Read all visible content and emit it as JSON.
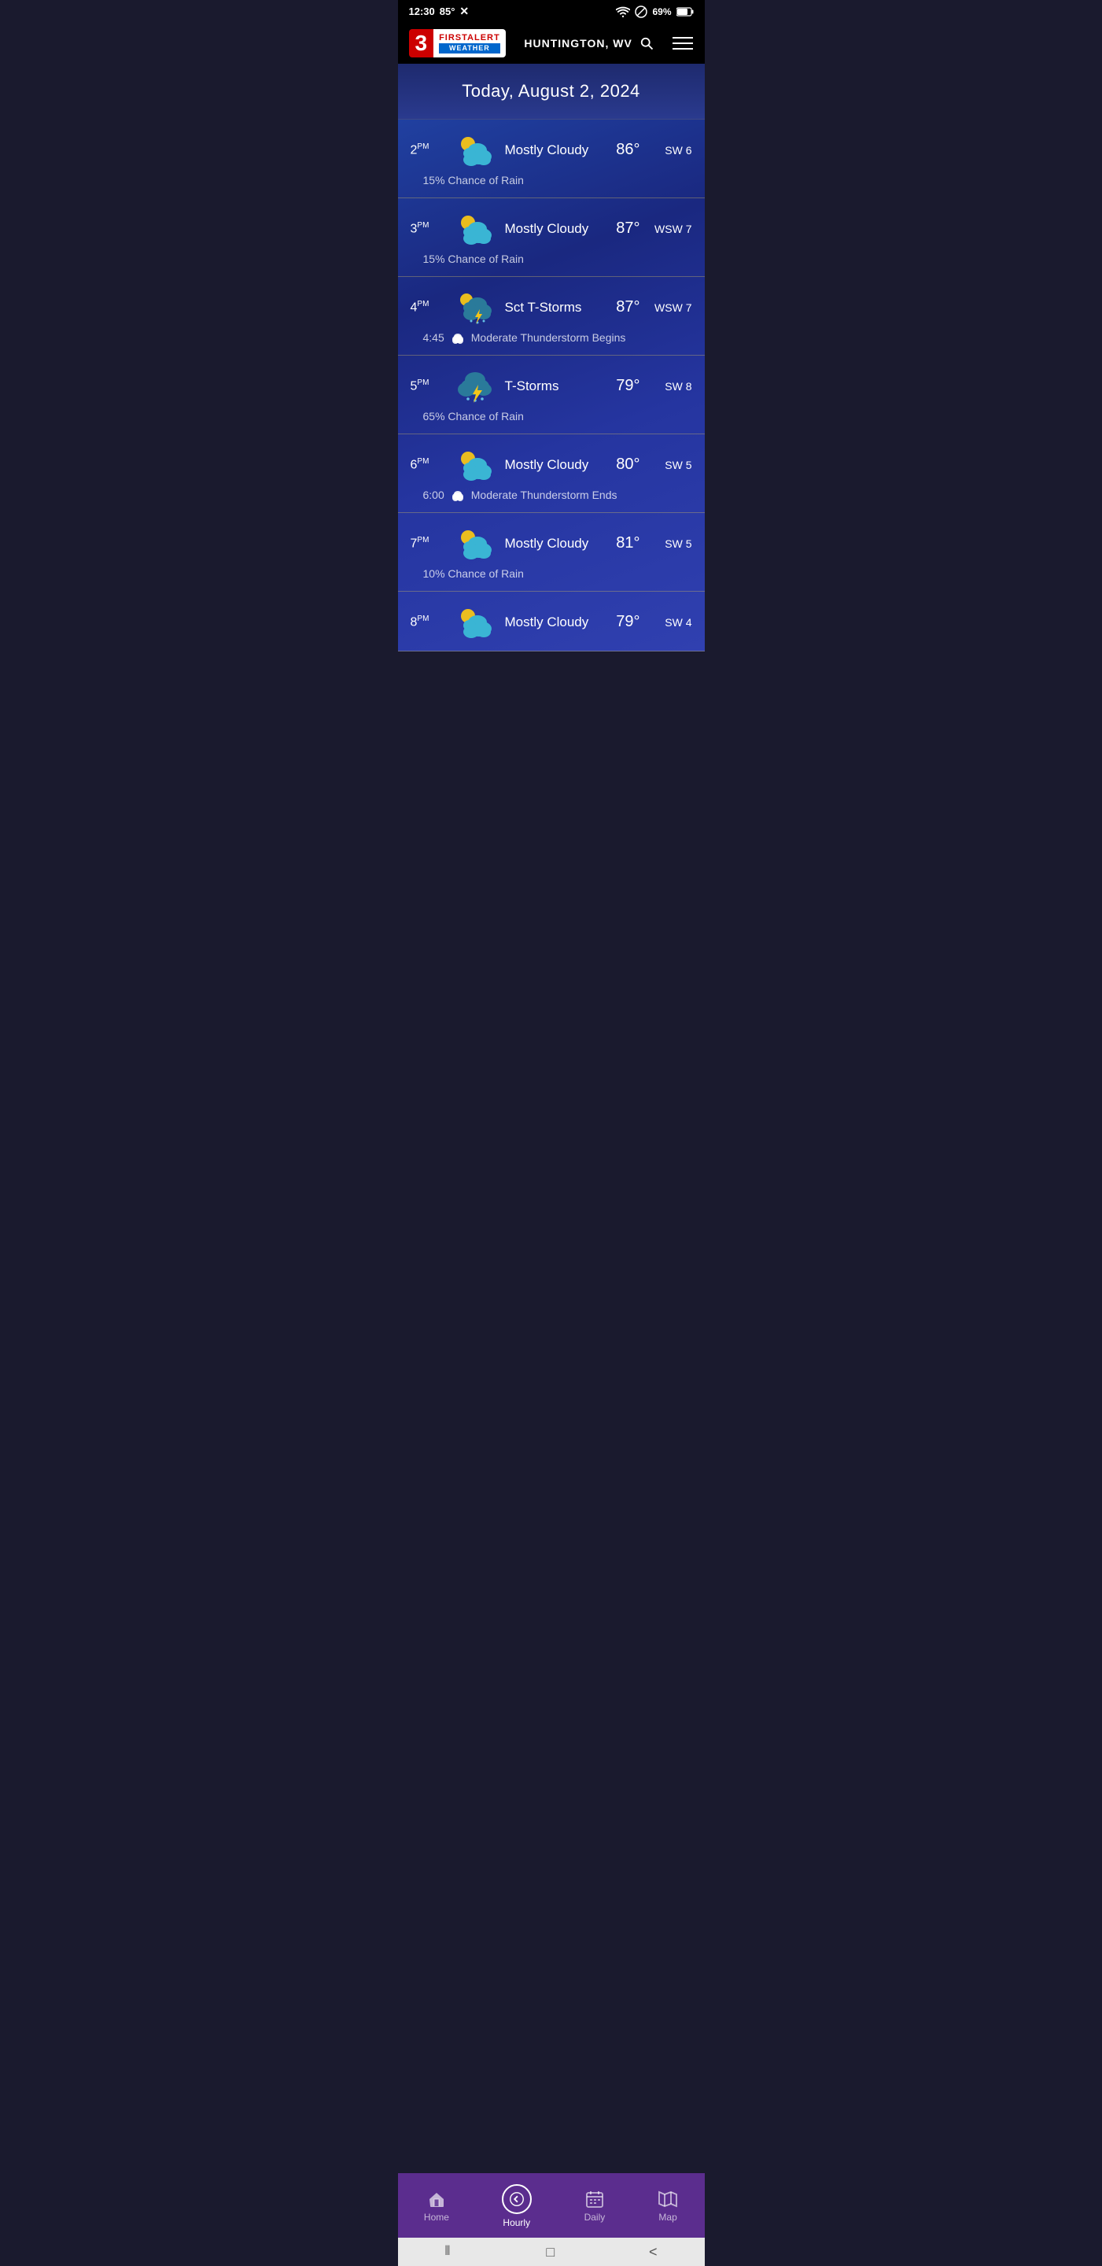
{
  "statusBar": {
    "time": "12:30",
    "temp": "85°",
    "battery": "69%"
  },
  "header": {
    "channel": "3",
    "firstAlert": "FIRSTALERT",
    "weather": "WEATHER",
    "location": "HUNTINGTON, WV",
    "searchLabel": "search",
    "menuLabel": "menu"
  },
  "dateHeader": {
    "label": "Today, August 2, 2024"
  },
  "hourlyRows": [
    {
      "id": "2pm",
      "time": "2",
      "period": "PM",
      "icon": "mostly-cloudy-sun",
      "condition": "Mostly Cloudy",
      "temp": "86°",
      "wind": "SW 6",
      "detail": "15% Chance of Rain",
      "detailType": "text"
    },
    {
      "id": "3pm",
      "time": "3",
      "period": "PM",
      "icon": "mostly-cloudy-sun",
      "condition": "Mostly Cloudy",
      "temp": "87°",
      "wind": "WSW 7",
      "detail": "15% Chance of Rain",
      "detailType": "text"
    },
    {
      "id": "4pm",
      "time": "4",
      "period": "PM",
      "icon": "sct-tstorms",
      "condition": "Sct T-Storms",
      "temp": "87°",
      "wind": "WSW 7",
      "detailTime": "4:45",
      "detail": "Moderate Thunderstorm Begins",
      "detailType": "event"
    },
    {
      "id": "5pm",
      "time": "5",
      "period": "PM",
      "icon": "tstorms",
      "condition": "T-Storms",
      "temp": "79°",
      "wind": "SW 8",
      "detail": "65% Chance of Rain",
      "detailType": "text"
    },
    {
      "id": "6pm",
      "time": "6",
      "period": "PM",
      "icon": "mostly-cloudy-sun",
      "condition": "Mostly Cloudy",
      "temp": "80°",
      "wind": "SW 5",
      "detailTime": "6:00",
      "detail": "Moderate Thunderstorm Ends",
      "detailType": "event"
    },
    {
      "id": "7pm",
      "time": "7",
      "period": "PM",
      "icon": "mostly-cloudy-sun",
      "condition": "Mostly Cloudy",
      "temp": "81°",
      "wind": "SW 5",
      "detail": "10% Chance of Rain",
      "detailType": "text"
    },
    {
      "id": "8pm",
      "time": "8",
      "period": "PM",
      "icon": "mostly-cloudy-night",
      "condition": "Mostly Cloudy",
      "temp": "79°",
      "wind": "SW 4",
      "detail": "",
      "detailType": "none"
    }
  ],
  "bottomNav": {
    "items": [
      {
        "id": "home",
        "label": "Home",
        "icon": "home",
        "active": false
      },
      {
        "id": "hourly",
        "label": "Hourly",
        "icon": "back-circle",
        "active": true
      },
      {
        "id": "daily",
        "label": "Daily",
        "icon": "calendar",
        "active": false
      },
      {
        "id": "map",
        "label": "Map",
        "icon": "map",
        "active": false
      }
    ]
  }
}
